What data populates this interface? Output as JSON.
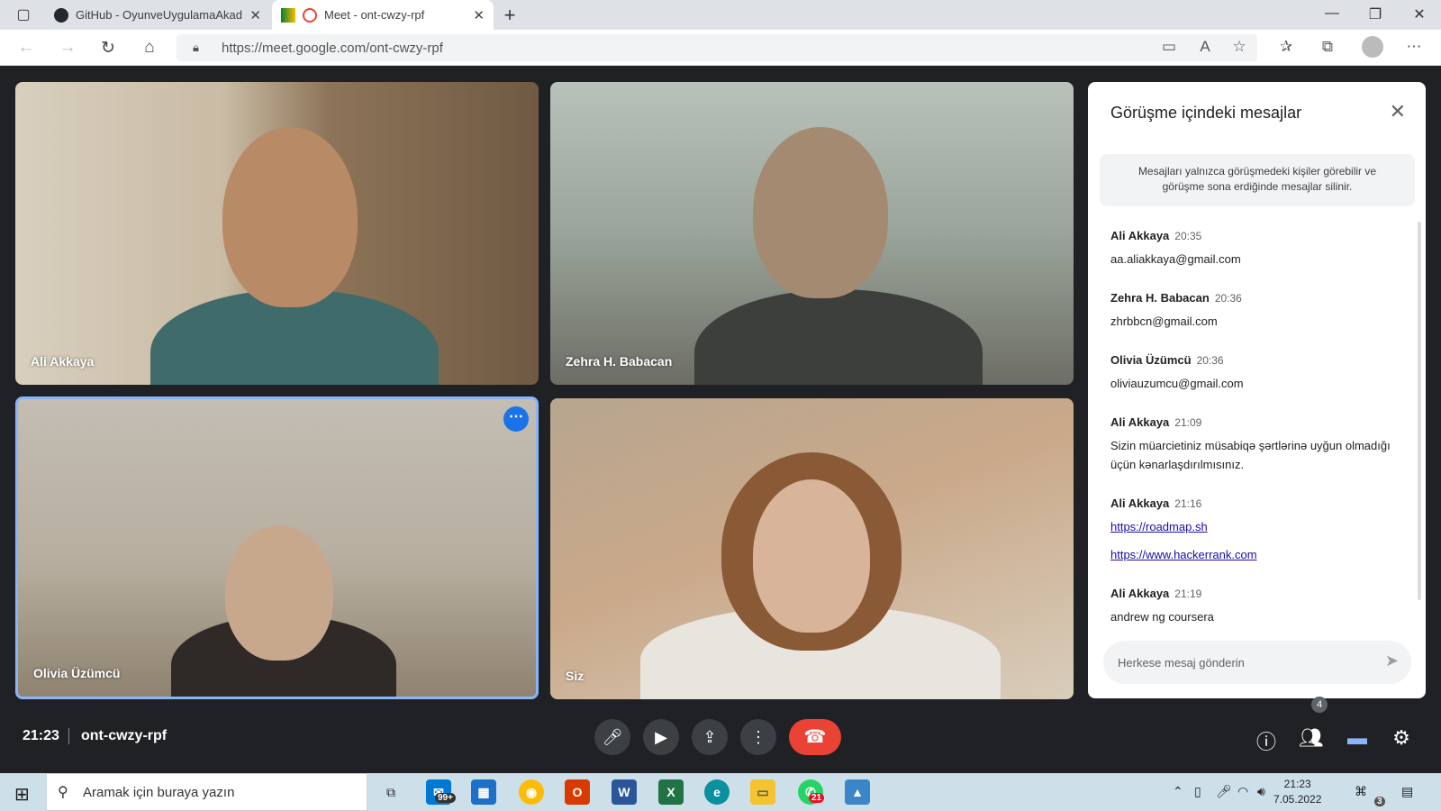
{
  "browser": {
    "tabs": [
      {
        "label": "GitHub - OyunveUygulamaAkad",
        "close": "✕"
      },
      {
        "label": "Meet - ont-cwzy-rpf",
        "close": "✕"
      }
    ],
    "new_tab": "+",
    "url": "https://meet.google.com/ont-cwzy-rpf"
  },
  "meeting": {
    "participants": [
      {
        "name": "Ali Akkaya"
      },
      {
        "name": "Zehra H. Babacan"
      },
      {
        "name": "Olivia Üzümcü"
      },
      {
        "name": "Siz"
      }
    ],
    "time": "21:23",
    "code": "ont-cwzy-rpf",
    "people_count": "4"
  },
  "chat": {
    "title": "Görüşme içindeki mesajlar",
    "notice": "Mesajları yalnızca görüşmedeki kişiler görebilir ve görüşme sona erdiğinde mesajlar silinir.",
    "messages": [
      {
        "sender": "Ali Akkaya",
        "time": "20:35",
        "text": "aa.aliakkaya@gmail.com"
      },
      {
        "sender": "Zehra H. Babacan",
        "time": "20:36",
        "text": "zhrbbcn@gmail.com"
      },
      {
        "sender": "Olivia Üzümcü",
        "time": "20:36",
        "text": "oliviauzumcu@gmail.com"
      },
      {
        "sender": "Ali Akkaya",
        "time": "21:09",
        "text": "Sizin müarcietiniz müsabiqə şərtlərinə uyğun olmadığı üçün kənarlaşdırılmısınız."
      },
      {
        "sender": "Ali Akkaya",
        "time": "21:16",
        "link1": "https://roadmap.sh",
        "link2": "https://www.hackerrank.com"
      },
      {
        "sender": "Ali Akkaya",
        "time": "21:19",
        "text": "andrew ng coursera"
      }
    ],
    "input_placeholder": "Herkese mesaj gönderin"
  },
  "taskbar": {
    "search_placeholder": "Aramak için buraya yazın",
    "mail_badge": "99+",
    "whatsapp_badge": "21",
    "clock_time": "21:23",
    "clock_date": "7.05.2022",
    "notif_count": "3"
  }
}
